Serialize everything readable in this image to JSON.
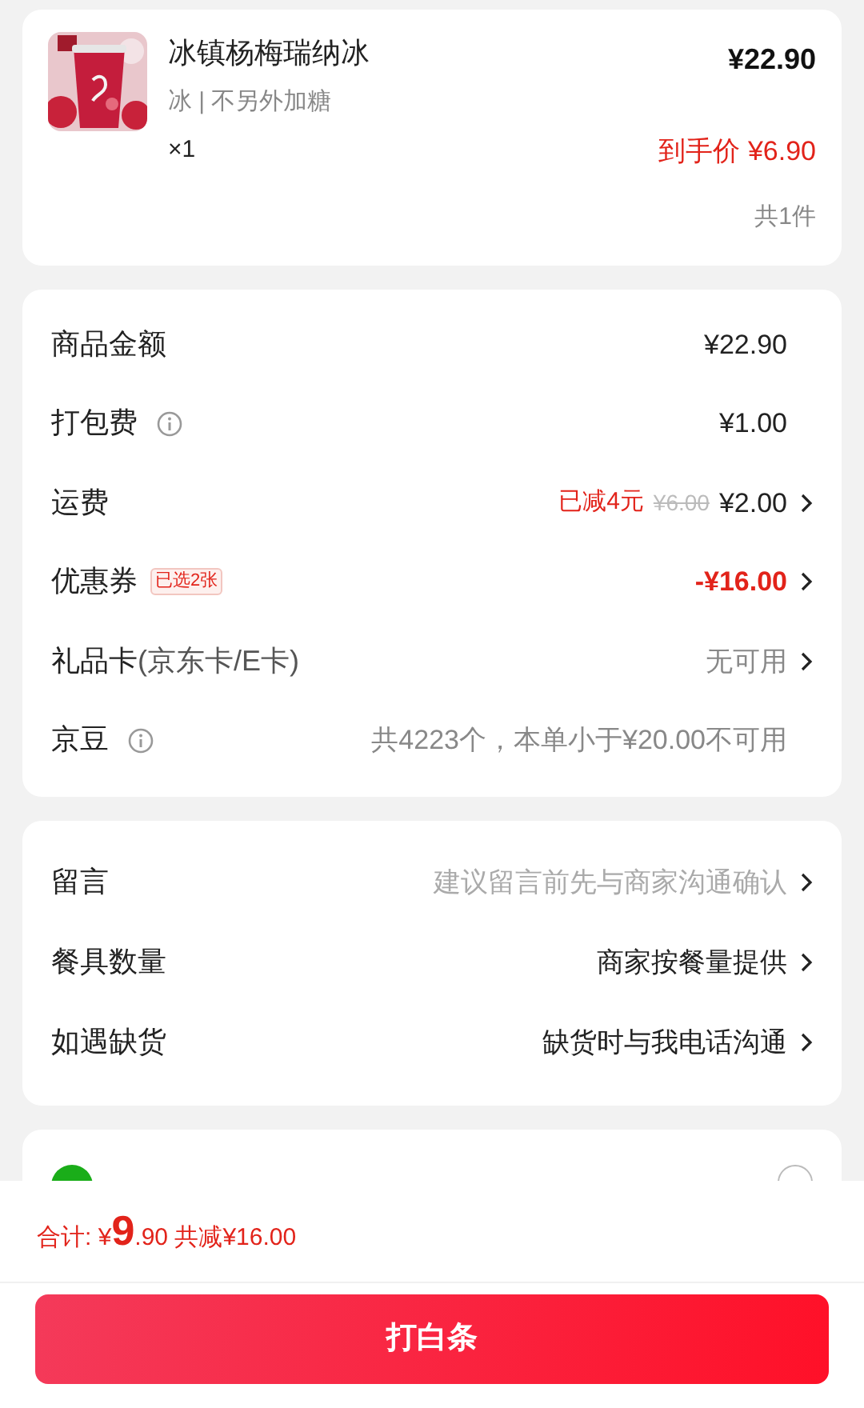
{
  "product": {
    "name": "冰镇杨梅瑞纳冰",
    "options": "冰 | 不另外加糖",
    "quantity": "×1",
    "price": "¥22.90",
    "final_label": "到手价",
    "final_price": "¥6.90",
    "count": "共1件"
  },
  "fees": [
    {
      "label": "商品金额",
      "info": false,
      "value": "¥22.90",
      "kind": "plain",
      "chevron": false
    },
    {
      "label": "打包费",
      "info": true,
      "value": "¥1.00",
      "kind": "plain",
      "chevron": false
    },
    {
      "label": "运费",
      "info": false,
      "reduction": "已减4元",
      "original": "¥6.00",
      "value": "¥2.00",
      "kind": "plain",
      "chevron": true
    },
    {
      "label": "优惠券",
      "info": false,
      "badge": "已选2张",
      "value": "-¥16.00",
      "kind": "discount",
      "chevron": true
    },
    {
      "label": "礼品卡",
      "label_note": "(京东卡/E卡)",
      "info": false,
      "value": "无可用",
      "kind": "muted",
      "chevron": true
    },
    {
      "label": "京豆",
      "info": true,
      "value": "共4223个，本单小于¥20.00不可用",
      "kind": "muted",
      "chevron": false
    }
  ],
  "options": [
    {
      "label": "留言",
      "value": "建议留言前先与商家沟通确认",
      "placeholder": true
    },
    {
      "label": "餐具数量",
      "value": "商家按餐量提供",
      "placeholder": false
    },
    {
      "label": "如遇缺货",
      "value": "缺货时与我电话沟通",
      "placeholder": false
    }
  ],
  "payment": {
    "selected": false
  },
  "footer": {
    "total_label": "合计:",
    "currency": "¥",
    "total_int": "9",
    "total_dec": ".90",
    "saved": "共减¥16.00",
    "button": "打白条"
  }
}
